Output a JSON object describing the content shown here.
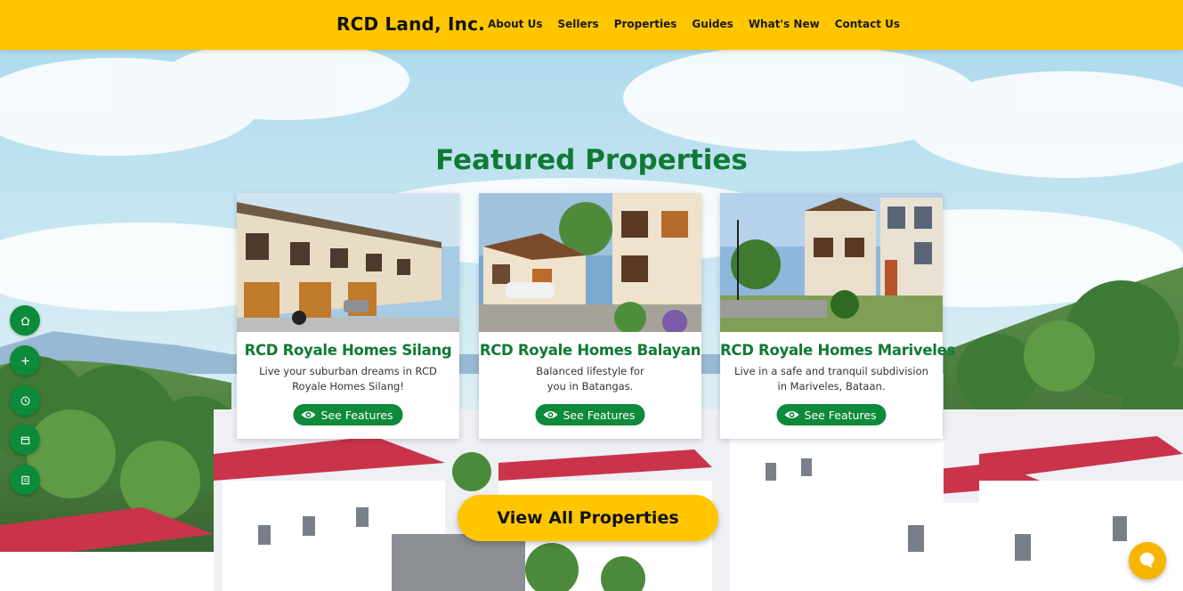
{
  "brand": {
    "name": "RCD Land, Inc."
  },
  "nav": {
    "items": [
      "About Us",
      "Sellers",
      "Properties",
      "Guides",
      "What's New",
      "Contact Us"
    ]
  },
  "featured": {
    "title": "Featured Properties",
    "cards": [
      {
        "title": "RCD Royale Homes Silang",
        "description": "Live your suburban dreams in RCD Royale Homes Silang!",
        "button": "See Features"
      },
      {
        "title": "RCD Royale Homes Balayan",
        "description": "Balanced lifestyle for you in Batangas.",
        "button": "See Features"
      },
      {
        "title": "RCD Royale Homes Mariveles",
        "description": "Live in a safe and tranquil subdivision in Mariveles, Bataan.",
        "button": "See Features"
      }
    ],
    "view_all": "View All Properties"
  },
  "side_buttons": [
    "home-icon",
    "plus-icon",
    "clock-icon",
    "calendar-icon",
    "document-icon"
  ],
  "colors": {
    "header": "#ffc600",
    "accent_green": "#0d8a3a",
    "title_green": "#0f7a35",
    "cta_yellow": "#ffc600"
  }
}
